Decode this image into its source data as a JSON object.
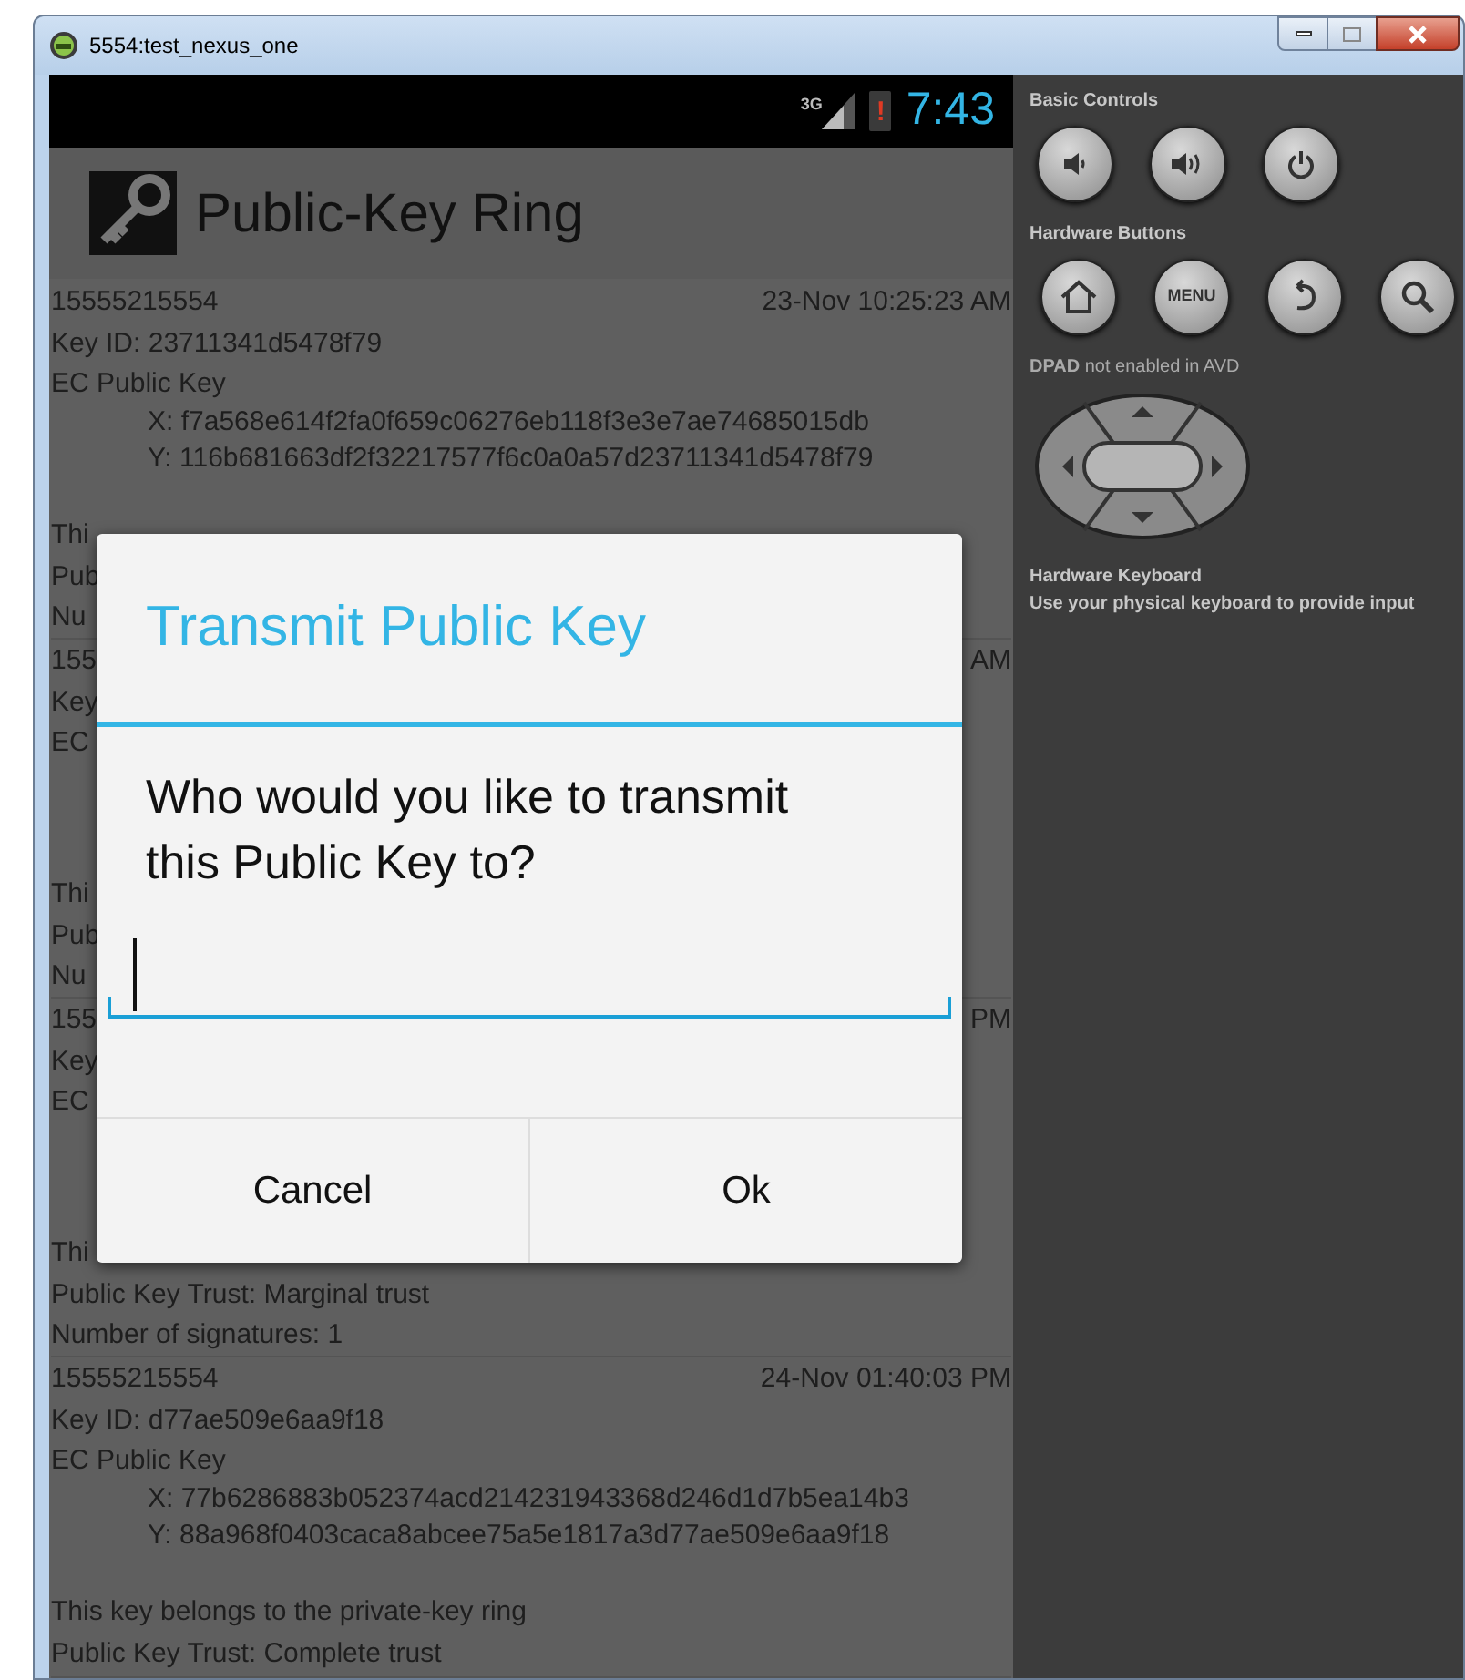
{
  "window": {
    "title": "5554:test_nexus_one"
  },
  "status_bar": {
    "network": "3G",
    "time": "7:43",
    "battery_alert": "!"
  },
  "action_bar": {
    "title": "Public-Key Ring"
  },
  "keys": [
    {
      "phone": "15555215554",
      "date": "23-Nov 10:25:23 AM",
      "key_id": "Key ID: 23711341d5478f79",
      "key_type": "EC Public Key",
      "x": "X: f7a568e614f2fa0f659c06276eb118f3e3e7ae74685015db",
      "y": "Y: 116b681663df2f32217577f6c0a0a57d23711341d5478f79",
      "ring": "Thi",
      "trust": "Pub",
      "signatures": "Nu"
    },
    {
      "phone": "155",
      "date": "AM",
      "key_id": "Key",
      "key_type": "EC",
      "ring": "Thi",
      "trust": "Pub",
      "signatures": "Nu"
    },
    {
      "phone": "155",
      "date": "PM",
      "key_id": "Key",
      "key_type": "EC",
      "ring": "Thi",
      "trust": "Public Key Trust: Marginal trust",
      "signatures": "Number of signatures: 1"
    },
    {
      "phone": "15555215554",
      "date": "24-Nov 01:40:03 PM",
      "key_id": "Key ID: d77ae509e6aa9f18",
      "key_type": "EC Public Key",
      "x": "X: 77b6286883b052374acd214231943368d246d1d7b5ea14b3",
      "y": "Y: 88a968f0403caca8abcee75a5e1817a3d77ae509e6aa9f18",
      "ring": "This key belongs to the private-key ring",
      "trust": "Public Key Trust: Complete trust"
    }
  ],
  "dialog": {
    "title": "Transmit Public Key",
    "message": "Who would you like to transmit this Public Key to?",
    "buttons": [
      "Cancel",
      "Ok"
    ]
  },
  "controls": {
    "basic_label": "Basic Controls",
    "hardware_label": "Hardware Buttons",
    "menu_key": "MENU",
    "dpad_note": "**DPAD** not enabled in AVD",
    "keyboard_label": "Hardware Keyboard",
    "keyboard_note": "Use your physical keyboard to provide input"
  }
}
